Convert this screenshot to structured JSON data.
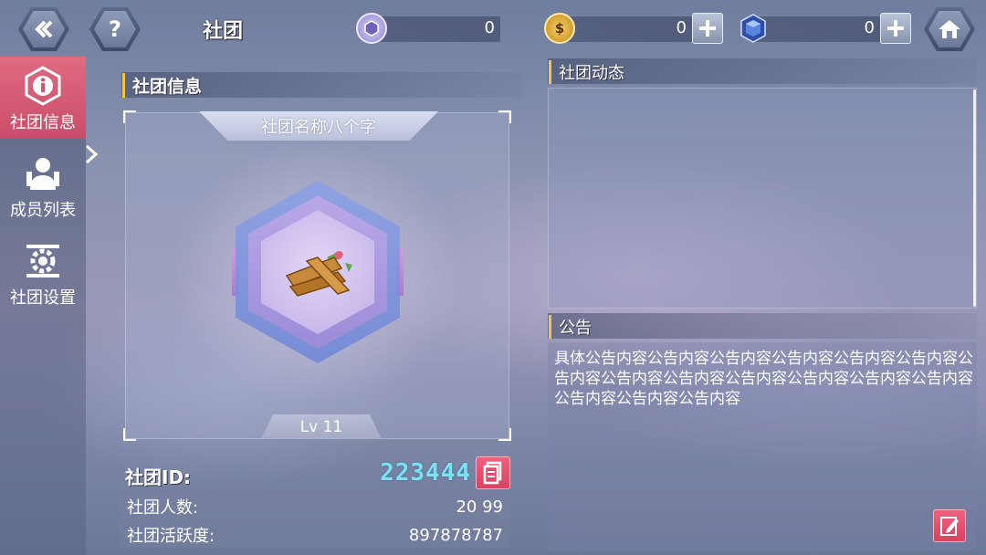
{
  "header": {
    "title": "社团",
    "back_icon": "back-chevron-icon",
    "help_label": "?",
    "home_icon": "home-icon",
    "resources": [
      {
        "icon": "badge-coin-icon",
        "value": "0"
      },
      {
        "icon": "gold-coin-icon",
        "glyph": "$",
        "value": "0"
      },
      {
        "icon": "crystal-gem-icon",
        "value": "0"
      }
    ]
  },
  "sidebar": {
    "items": [
      {
        "label": "社团信息",
        "icon": "info-icon",
        "active": true
      },
      {
        "label": "成员列表",
        "icon": "members-icon",
        "active": false
      },
      {
        "label": "社团设置",
        "icon": "settings-gear-icon",
        "active": false
      }
    ]
  },
  "club_info": {
    "section_title": "社团信息",
    "club_name": "社团名称八个字",
    "level": "Lv 11",
    "id_label": "社团ID:",
    "id_value": "223444",
    "stats": [
      {
        "label": "社团人数:",
        "value": "20 99"
      },
      {
        "label": "社团活跃度:",
        "value": "897878787"
      }
    ]
  },
  "club_feed": {
    "section_title": "社团动态"
  },
  "notice": {
    "section_title": "公告",
    "content": "具体公告内容公告内容公告内容公告内容公告内容公告内容公告内容公告内容公告内容公告内容公告内容公告内容公告内容公告内容公告内容公告内容"
  },
  "colors": {
    "accent_pink": "#e0607e",
    "id_cyan": "#7fe0f0",
    "title_marker": "#f2c54a"
  }
}
